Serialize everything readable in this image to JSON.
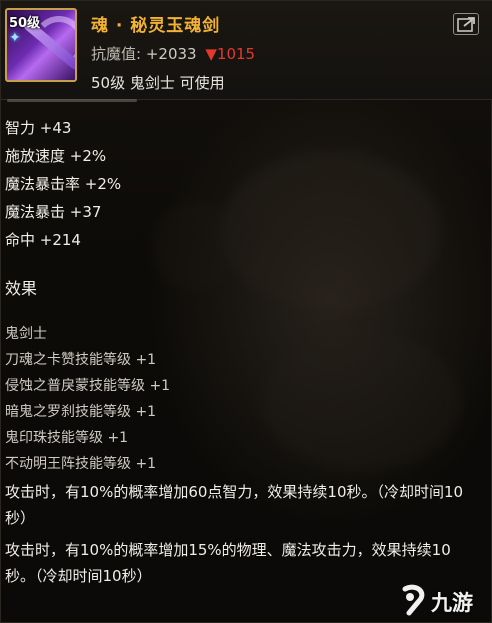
{
  "header": {
    "item_name": "魂 · 秘灵玉魂剑",
    "level_badge": "50级",
    "resist_label": "抗魔值:",
    "resist_value": "+2033",
    "resist_drop": "1015",
    "requirement": "50级  鬼剑士  可使用"
  },
  "stats": [
    "智力 +43",
    "施放速度 +2%",
    "魔法暴击率 +2%",
    "魔法暴击 +37",
    "命中 +214"
  ],
  "effects_title": "效果",
  "effects": [
    "鬼剑士",
    "刀魂之卡赞技能等级 +1",
    "侵蚀之普戾蒙技能等级 +1",
    "暗鬼之罗刹技能等级 +1",
    "鬼印珠技能等级 +1",
    "不动明王阵技能等级 +1"
  ],
  "descriptions": [
    "攻击时，有10%的概率增加60点智力，效果持续10秒。（冷却时间10秒）",
    "攻击时，有10%的概率增加15%的物理、魔法攻击力，效果持续10秒。（冷却时间10秒）"
  ],
  "watermark": {
    "text": "九游"
  },
  "icons": {
    "share": "share-icon",
    "star": "star-icon",
    "drop": "down-arrow-icon",
    "logo": "jiuyou-logo-icon"
  },
  "colors": {
    "item_name": "#f2b233",
    "drop": "#e23a2a",
    "frame_border": "#c7a04a"
  }
}
